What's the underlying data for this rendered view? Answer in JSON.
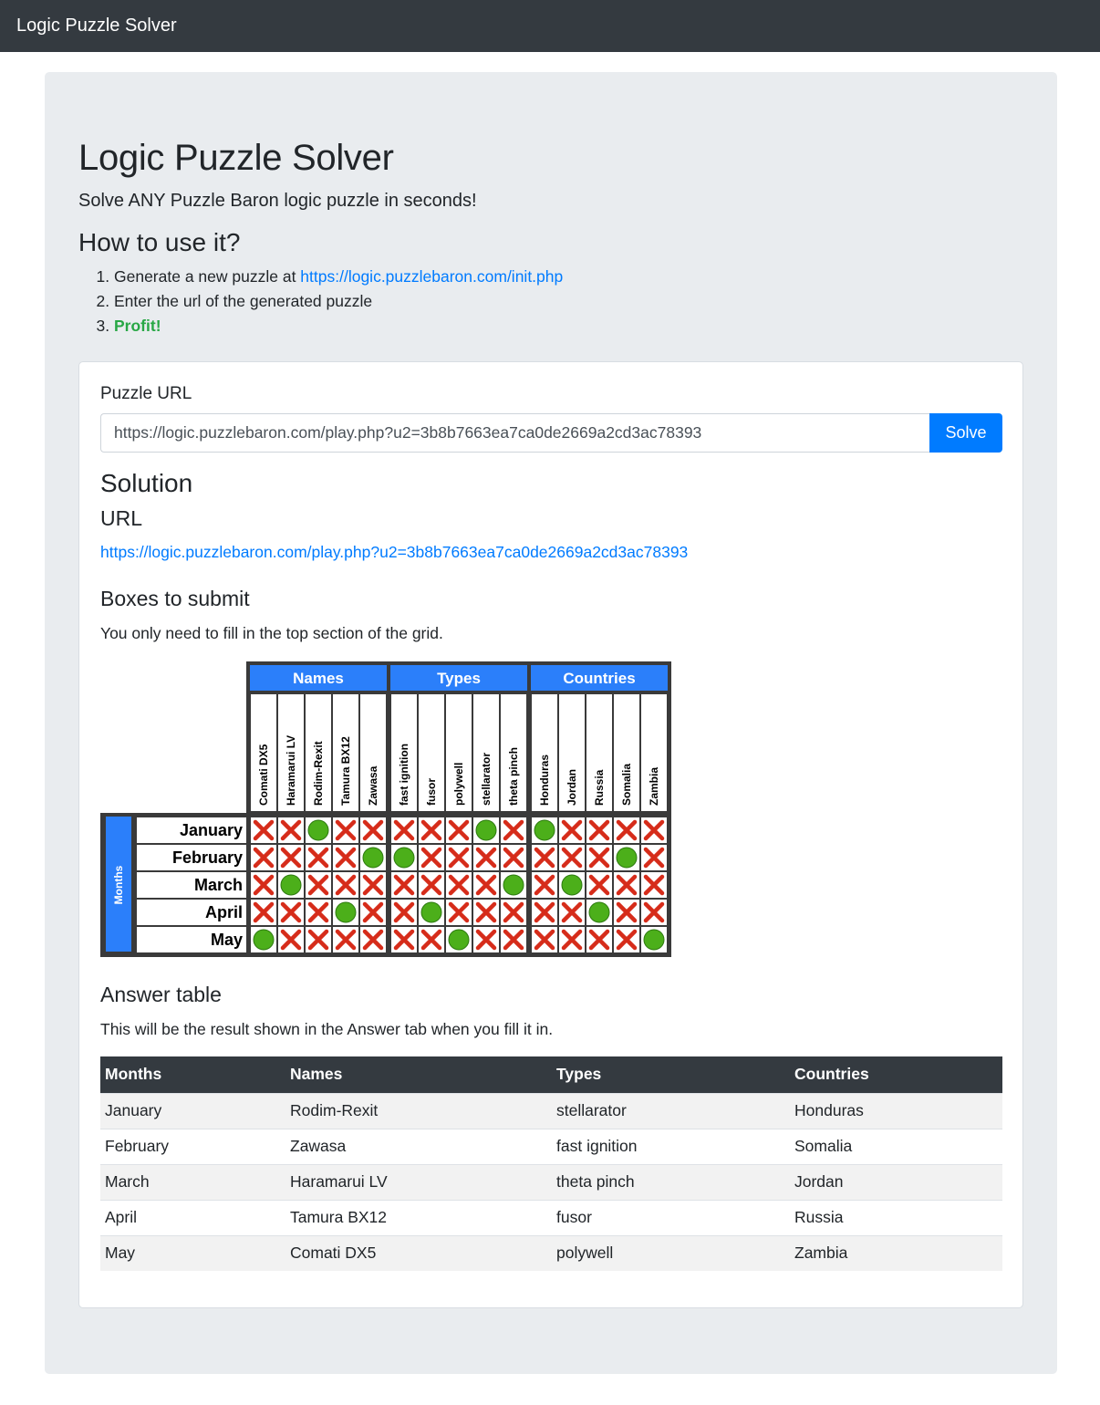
{
  "navbar": {
    "brand": "Logic Puzzle Solver"
  },
  "hero": {
    "title": "Logic Puzzle Solver",
    "lead": "Solve ANY Puzzle Baron logic puzzle in seconds!",
    "howto_title": "How to use it?",
    "step1_text": "Generate a new puzzle at ",
    "step1_link": "https://logic.puzzlebaron.com/init.php",
    "step2_text": "Enter the url of the generated puzzle",
    "step3_text": "Profit!"
  },
  "form": {
    "label": "Puzzle URL",
    "url_value": "https://logic.puzzlebaron.com/play.php?u2=3b8b7663ea7ca0de2669a2cd3ac78393",
    "solve_label": "Solve"
  },
  "solution": {
    "title": "Solution",
    "url_title": "URL",
    "url": "https://logic.puzzlebaron.com/play.php?u2=3b8b7663ea7ca0de2669a2cd3ac78393",
    "boxes_title": "Boxes to submit",
    "boxes_note": "You only need to fill in the top section of the grid."
  },
  "grid": {
    "row_group": "Months",
    "rows": [
      "January",
      "February",
      "March",
      "April",
      "May"
    ],
    "groups": [
      {
        "name": "Names",
        "items": [
          "Comati DX5",
          "Haramarui LV",
          "Rodim-Rexit",
          "Tamura BX12",
          "Zawasa"
        ]
      },
      {
        "name": "Types",
        "items": [
          "fast ignition",
          "fusor",
          "polywell",
          "stellarator",
          "theta pinch"
        ]
      },
      {
        "name": "Countries",
        "items": [
          "Honduras",
          "Jordan",
          "Russia",
          "Somalia",
          "Zambia"
        ]
      }
    ],
    "matches": [
      [
        2,
        3,
        0
      ],
      [
        4,
        0,
        3
      ],
      [
        1,
        4,
        1
      ],
      [
        3,
        1,
        2
      ],
      [
        0,
        2,
        4
      ]
    ],
    "colors": {
      "header": "#2b7ffa",
      "frame": "#3a3a3a",
      "yes": "#4caf1a",
      "no": "#d62c1a"
    }
  },
  "answer": {
    "title": "Answer table",
    "note": "This will be the result shown in the Answer tab when you fill it in.",
    "headers": [
      "Months",
      "Names",
      "Types",
      "Countries"
    ],
    "rows": [
      [
        "January",
        "Rodim-Rexit",
        "stellarator",
        "Honduras"
      ],
      [
        "February",
        "Zawasa",
        "fast ignition",
        "Somalia"
      ],
      [
        "March",
        "Haramarui LV",
        "theta pinch",
        "Jordan"
      ],
      [
        "April",
        "Tamura BX12",
        "fusor",
        "Russia"
      ],
      [
        "May",
        "Comati DX5",
        "polywell",
        "Zambia"
      ]
    ]
  }
}
